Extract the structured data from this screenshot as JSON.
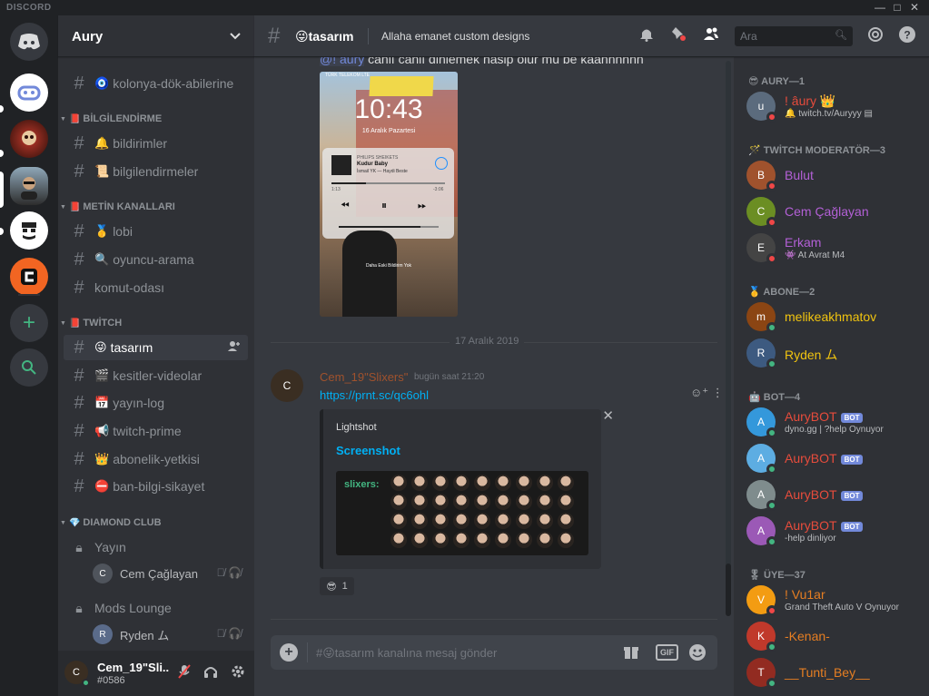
{
  "app": {
    "brand": "DISCORD"
  },
  "window_controls": [
    "—",
    "□",
    "✕"
  ],
  "guilds": {
    "home_icon": "discord-logo-icon",
    "add_icon": "+",
    "discover_icon": "search-icon"
  },
  "server": {
    "name": "Aury",
    "chevron": "⌄"
  },
  "channels": {
    "top": [
      {
        "emoji": "🧿",
        "name": "kolonya-dök-abilerine"
      }
    ],
    "categories": [
      {
        "emoji": "📕",
        "name": "BİLGİLENDİRME",
        "channels": [
          {
            "emoji": "🔔",
            "name": "bildirimler"
          },
          {
            "emoji": "📜",
            "name": "bilgilendirmeler"
          }
        ]
      },
      {
        "emoji": "📕",
        "name": "METİN KANALLARI",
        "channels": [
          {
            "emoji": "🥇",
            "name": "lobi"
          },
          {
            "emoji": "🔍",
            "name": "oyuncu-arama"
          },
          {
            "emoji": "",
            "name": "komut-odası"
          }
        ]
      },
      {
        "emoji": "📕",
        "name": "TWİTCH",
        "channels": [
          {
            "emoji": "😜",
            "name": "tasarım"
          },
          {
            "emoji": "🎬",
            "name": "kesitler-videolar"
          },
          {
            "emoji": "📅",
            "name": "yayın-log"
          },
          {
            "emoji": "📢",
            "name": "twitch-prime"
          },
          {
            "emoji": "👑",
            "name": "abonelik-yetkisi"
          },
          {
            "emoji": "⛔",
            "name": "ban-bilgi-sikayet"
          }
        ]
      },
      {
        "emoji": "💎",
        "name": "DIAMOND CLUB",
        "voice": [
          {
            "name": "Yayın",
            "user": "Cem Çağlayan"
          },
          {
            "name": "Mods Lounge",
            "user": "Ryden ム"
          }
        ]
      }
    ]
  },
  "user_panel": {
    "name": "Cem_19\"Sli...",
    "tag": "#0586"
  },
  "chat": {
    "channel_name": "tasarım",
    "channel_emoji": "😜",
    "topic": "Allaha emanet custom designs",
    "search_placeholder": "Ara",
    "top_message_mention": "@! âury",
    "top_message_text": " canlı canlı dinlemek nasip olur mu be kaanhhhhh",
    "phone": {
      "carrier": "TÜRK TELEKOM LTE",
      "time": "10:43",
      "date": "16 Aralık Pazartesi",
      "track_artist": "PHILIPS SHEIKETS",
      "track_title": "Kudur Baby",
      "track_sub": "İsmail YK — Haydi Beste",
      "elapsed": "1:13",
      "remaining": "-3:06",
      "hint": "Daha Eski Bildirim Yok"
    },
    "date_divider": "17 Aralık 2019",
    "message": {
      "author": "Cem_19\"Slixers\"",
      "timestamp": "bugün saat 21:20",
      "link": "https://prnt.sc/qc6ohl",
      "embed_provider": "Lightshot",
      "embed_title": "Screenshot",
      "embed_image_text": "slixers:",
      "reaction_count": "1"
    },
    "composer_placeholder": "tasarım kanalına mesaj gönder",
    "composer_prefix": "#😜",
    "gif_label": "GIF"
  },
  "members": {
    "groups": [
      {
        "label": "AURY—1",
        "emoji": "😎",
        "members": [
          {
            "name": "! âury",
            "suffix": "👑",
            "color": "#e74c3c",
            "activity": "🔔 twitch.tv/Auryyy ▤"
          }
        ]
      },
      {
        "label": "TWİTCH MODERATÖR—3",
        "emoji": "🪄",
        "members": [
          {
            "name": "Bulut",
            "color": "#b360d6",
            "activity": ""
          },
          {
            "name": "Cem Çağlayan",
            "color": "#b360d6",
            "activity": ""
          },
          {
            "name": "Erkam",
            "color": "#b360d6",
            "activity": "👾 At Avrat M4"
          }
        ]
      },
      {
        "label": "ABONE—2",
        "emoji": "🥇",
        "members": [
          {
            "name": "melikeakhmatov",
            "color": "#f1c40f",
            "activity": ""
          },
          {
            "name": "Ryden ム",
            "color": "#f1c40f",
            "activity": ""
          }
        ]
      },
      {
        "label": "BOT—4",
        "emoji": "🤖",
        "members": [
          {
            "name": "AuryBOT",
            "bot": "BOT",
            "color": "#e74c3c",
            "activity": "dyno.gg | ?help Oynuyor"
          },
          {
            "name": "AuryBOT",
            "bot": "BOT",
            "color": "#e74c3c",
            "activity": ""
          },
          {
            "name": "AuryBOT",
            "bot": "BOT",
            "color": "#e74c3c",
            "activity": ""
          },
          {
            "name": "AuryBOT",
            "bot": "BOT",
            "color": "#e74c3c",
            "activity": "-help dinliyor"
          }
        ]
      },
      {
        "label": "ÜYE—37",
        "emoji": "🎖",
        "members": [
          {
            "name": "! Vu1ar",
            "color": "#e67e22",
            "activity": "Grand Theft Auto V Oynuyor"
          },
          {
            "name": "-Kenan-",
            "color": "#e67e22",
            "activity": ""
          },
          {
            "name": "__Tunti_Bey__",
            "color": "#e67e22",
            "activity": ""
          }
        ]
      }
    ]
  },
  "colors": {
    "online": "#43b581",
    "dnd": "#f04747",
    "link": "#00b0f4",
    "blurple": "#7289da"
  }
}
